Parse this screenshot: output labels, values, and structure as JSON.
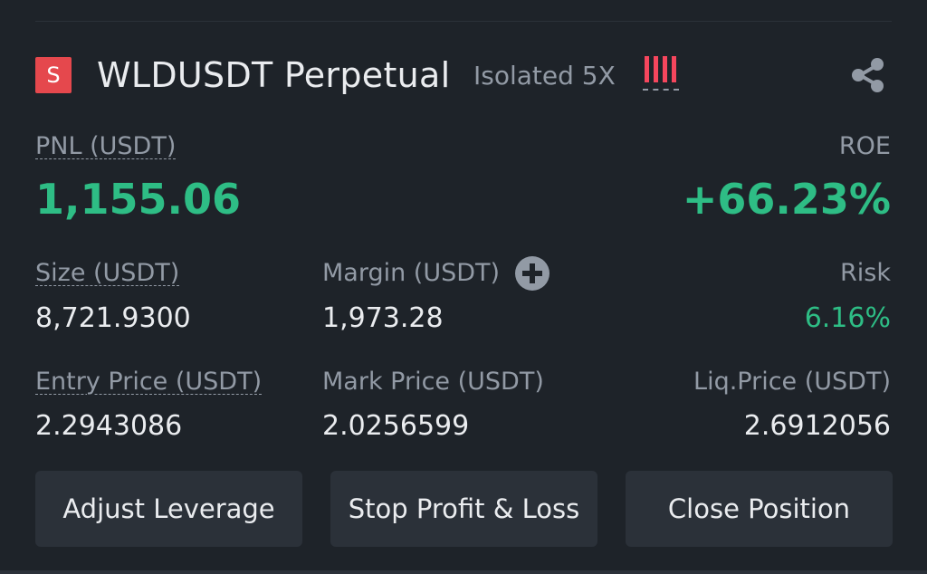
{
  "position": {
    "side_badge": "S",
    "symbol": "WLDUSDT Perpetual",
    "margin_mode": "Isolated 5X",
    "risk_bars_level": 4,
    "colors": {
      "background": "#1e2329",
      "profit": "#2ebd85",
      "short": "#e5484d",
      "muted": "#929aa5",
      "button": "#2b3139"
    }
  },
  "pnl": {
    "label": "PNL (USDT)",
    "value": "1,155.06"
  },
  "roe": {
    "label": "ROE",
    "value": "+66.23%"
  },
  "size": {
    "label": "Size (USDT)",
    "value": "8,721.9300"
  },
  "margin": {
    "label": "Margin (USDT)",
    "value": "1,973.28",
    "add_icon": "plus-circle-icon"
  },
  "risk": {
    "label": "Risk",
    "value": "6.16%"
  },
  "entry_price": {
    "label": "Entry Price (USDT)",
    "value": "2.2943086"
  },
  "mark_price": {
    "label": "Mark Price (USDT)",
    "value": "2.0256599"
  },
  "liq_price": {
    "label": "Liq.Price (USDT)",
    "value": "2.6912056"
  },
  "actions": {
    "adjust_leverage": "Adjust Leverage",
    "stop_profit_loss": "Stop Profit & Loss",
    "close_position": "Close Position"
  },
  "share_icon": "share-icon"
}
